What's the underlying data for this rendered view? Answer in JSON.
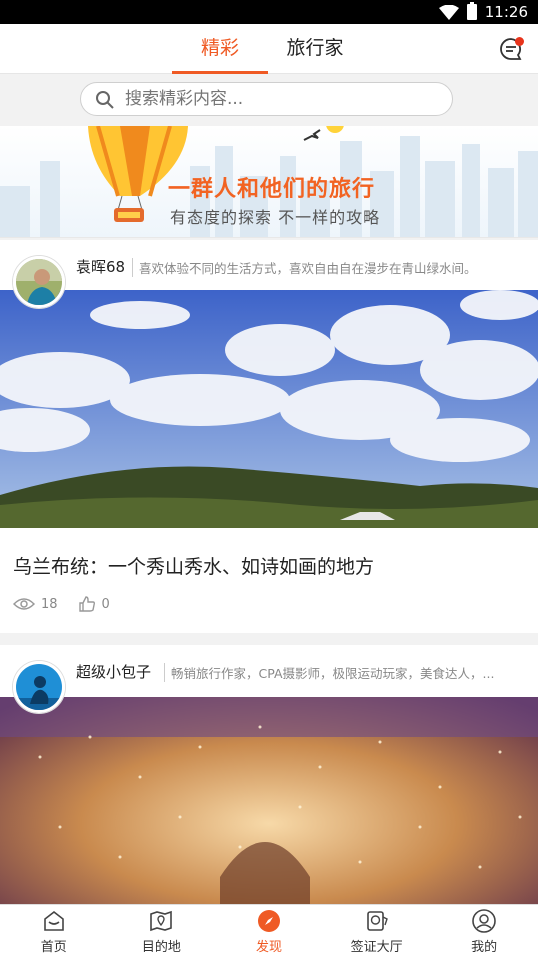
{
  "status_bar": {
    "time": "11:26"
  },
  "top_nav": {
    "tabs": [
      {
        "label": "精彩",
        "active": true
      },
      {
        "label": "旅行家",
        "active": false
      }
    ]
  },
  "search": {
    "placeholder": "搜索精彩内容..."
  },
  "banner": {
    "title": "一群人和他们的旅行",
    "subtitle": "有态度的探索 不一样的攻略"
  },
  "posts": [
    {
      "author": "袁晖68",
      "bio": "喜欢体验不同的生活方式，喜欢自由自在漫步在青山绿水间。",
      "title": "乌兰布统：一个秀山秀水、如诗如画的地方",
      "views": "18",
      "likes": "0"
    },
    {
      "author": "超级小包子",
      "bio": "畅销旅行作家，CPA摄影师，极限运动玩家，美食达人，..."
    }
  ],
  "bottom_nav": [
    {
      "label": "首页",
      "icon": "home-icon"
    },
    {
      "label": "目的地",
      "icon": "map-icon"
    },
    {
      "label": "发现",
      "icon": "compass-icon",
      "active": true
    },
    {
      "label": "签证大厅",
      "icon": "passport-icon"
    },
    {
      "label": "我的",
      "icon": "user-icon"
    }
  ],
  "colors": {
    "accent": "#ef5a24",
    "notify": "#e8341c"
  }
}
